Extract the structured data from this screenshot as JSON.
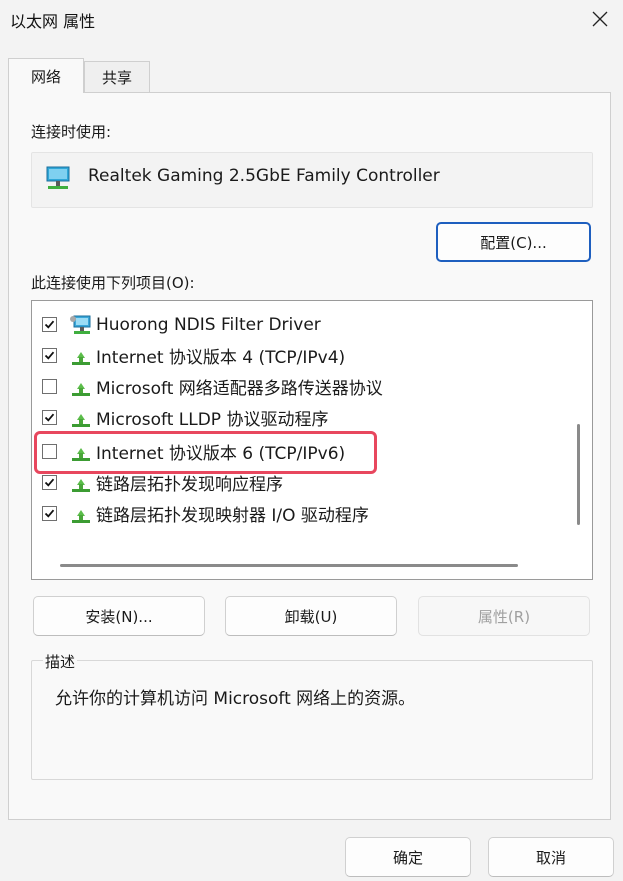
{
  "window": {
    "title": "以太网 属性",
    "close_icon": "close-icon"
  },
  "tabs": [
    {
      "label": "网络",
      "active": true
    },
    {
      "label": "共享",
      "active": false
    }
  ],
  "connect_using": {
    "label": "连接时使用:",
    "adapter_name": "Realtek Gaming 2.5GbE Family Controller",
    "adapter_icon": "network-adapter-icon",
    "configure_button": "配置(C)..."
  },
  "items_section": {
    "label": "此连接使用下列项目(O):",
    "items": [
      {
        "label": "Huorong NDIS Filter Driver",
        "checked": true,
        "icon": "network-service-icon"
      },
      {
        "label": "Internet 协议版本 4 (TCP/IPv4)",
        "checked": true,
        "icon": "protocol-icon"
      },
      {
        "label": "Microsoft 网络适配器多路传送器协议",
        "checked": false,
        "icon": "protocol-icon"
      },
      {
        "label": "Microsoft LLDP 协议驱动程序",
        "checked": true,
        "icon": "protocol-icon"
      },
      {
        "label": "Internet 协议版本 6 (TCP/IPv6)",
        "checked": false,
        "icon": "protocol-icon",
        "highlighted": true
      },
      {
        "label": "链路层拓扑发现响应程序",
        "checked": true,
        "icon": "protocol-icon"
      },
      {
        "label": "链路层拓扑发现映射器 I/O 驱动程序",
        "checked": true,
        "icon": "protocol-icon"
      }
    ]
  },
  "buttons": {
    "install": "安装(N)...",
    "uninstall": "卸载(U)",
    "properties": "属性(R)",
    "ok": "确定",
    "cancel": "取消"
  },
  "description": {
    "title": "描述",
    "text": "允许你的计算机访问 Microsoft 网络上的资源。"
  },
  "colors": {
    "highlight": "#e8475e",
    "accent": "#1e5fbf"
  }
}
